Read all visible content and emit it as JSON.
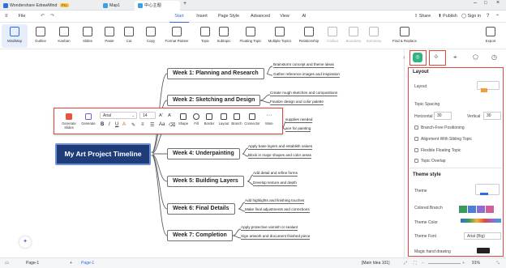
{
  "tabs": [
    {
      "label": "Wondershare EdrawMind",
      "badge": "Pro"
    },
    {
      "label": "Map1"
    },
    {
      "label": "中心主题"
    }
  ],
  "menu": {
    "file": "File",
    "items": [
      "Start",
      "Insert",
      "Page Style",
      "Advanced",
      "View",
      "AI"
    ],
    "right": {
      "share": "Share",
      "publish": "Publish",
      "sign_in": "Sign in"
    }
  },
  "views": [
    "MindMap",
    "Outline",
    "Kanban",
    "Slides"
  ],
  "toolbar": [
    "Paste",
    "Cut",
    "Copy",
    "Format Painter",
    "Topic",
    "Subtopic",
    "Floating Topic",
    "Multiple Topics",
    "Relationship",
    "Callout",
    "Boundary",
    "Summary",
    "Find & Replace",
    "Export"
  ],
  "map": {
    "root": "My Art Project Timeline",
    "topics": [
      {
        "label": "Week 1: Planning and Research",
        "subs": [
          "Brainstorm concept and theme ideas",
          "Gather reference images and inspiration"
        ]
      },
      {
        "label": "Week 2: Sketching and Design",
        "subs": [
          "Create rough sketches and compositions",
          "Finalize design and color palette"
        ]
      },
      {
        "label": "",
        "subs": [
          "supplies needed",
          "ace for painting"
        ]
      },
      {
        "label": "Week 4: Underpainting",
        "subs": [
          "Apply base layers and establish values",
          "Block in major shapes and color areas"
        ]
      },
      {
        "label": "Week 5: Building Layers",
        "subs": [
          "Add detail and refine forms",
          "Develop texture and depth"
        ]
      },
      {
        "label": "Week 6: Final Details",
        "subs": [
          "Add highlights and finishing touches",
          "Make final adjustments and corrections"
        ]
      },
      {
        "label": "Week 7: Completion",
        "subs": [
          "Apply protective varnish or sealant",
          "Sign artwork and document finished piece"
        ]
      }
    ]
  },
  "floatbar": {
    "generate_slides": "Generate Slides",
    "generate": "Generate",
    "font": "Arial",
    "size": "14",
    "items": [
      "Shape",
      "Fill",
      "Border",
      "Layout",
      "Branch",
      "Connector",
      "More"
    ]
  },
  "panel": {
    "layout_title": "Layout",
    "layout": "Layout",
    "topic_spacing": "Topic Spacing",
    "horizontal": "Horizontal",
    "horizontal_value": "30",
    "vertical": "Vertical",
    "vertical_value": "30",
    "options": [
      "Branch-Free Positioning",
      "Alignment With Sibling Topic",
      "Flexible Floating Topic",
      "Topic Overlap"
    ],
    "theme_title": "Theme style",
    "theme": "Theme",
    "colored_branch": "Colored Branch",
    "theme_color": "Theme Color",
    "theme_font": "Theme Font",
    "theme_font_value": "Arial (Big)",
    "magic": "Magic hand drawing"
  },
  "status": {
    "page": "Page-1",
    "page_tab": "Page-1",
    "main_idea": "[Main Idea 101]",
    "zoom": "91%"
  },
  "colors": {
    "accent": "#2f6de1",
    "highlight": "#e0473f",
    "root_fill": "#1f3c7a"
  }
}
